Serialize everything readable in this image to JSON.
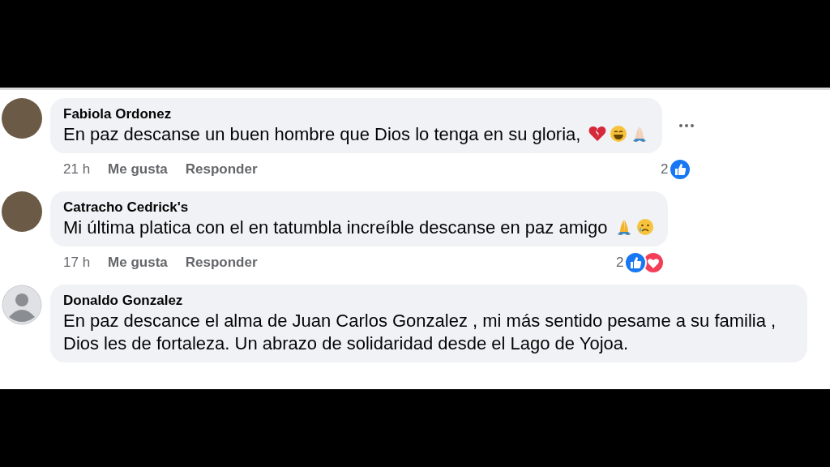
{
  "comments": [
    {
      "author": "Fabiola Ordonez",
      "avatar": {
        "kind": "photo"
      },
      "text": "En paz descanse un buen hombre que Dios lo tenga en su gloria,",
      "emojis": [
        {
          "kind": "broken-heart"
        },
        {
          "kind": "grin"
        },
        {
          "kind": "pray-light"
        }
      ],
      "time": "21 h",
      "like_label": "Me gusta",
      "reply_label": "Responder",
      "reaction_count": "2",
      "reactions": [
        {
          "kind": "like"
        }
      ],
      "menu": true
    },
    {
      "author": "Catracho Cedrick's",
      "avatar": {
        "kind": "photo"
      },
      "text": "Mi última platica con el en tatumbla increíble descanse en paz amigo",
      "emojis": [
        {
          "kind": "pray"
        },
        {
          "kind": "cry"
        }
      ],
      "time": "17 h",
      "like_label": "Me gusta",
      "reply_label": "Responder",
      "reaction_count": "2",
      "reactions": [
        {
          "kind": "like"
        },
        {
          "kind": "love"
        }
      ],
      "menu": false
    },
    {
      "author": "Donaldo Gonzalez",
      "avatar": {
        "kind": "default"
      },
      "text": "En paz descance el alma de Juan Carlos Gonzalez , mi más sentido pesame a su familia , Dios les de fortaleza. Un abrazo de solidaridad desde el Lago de Yojoa.",
      "menu": false
    }
  ]
}
